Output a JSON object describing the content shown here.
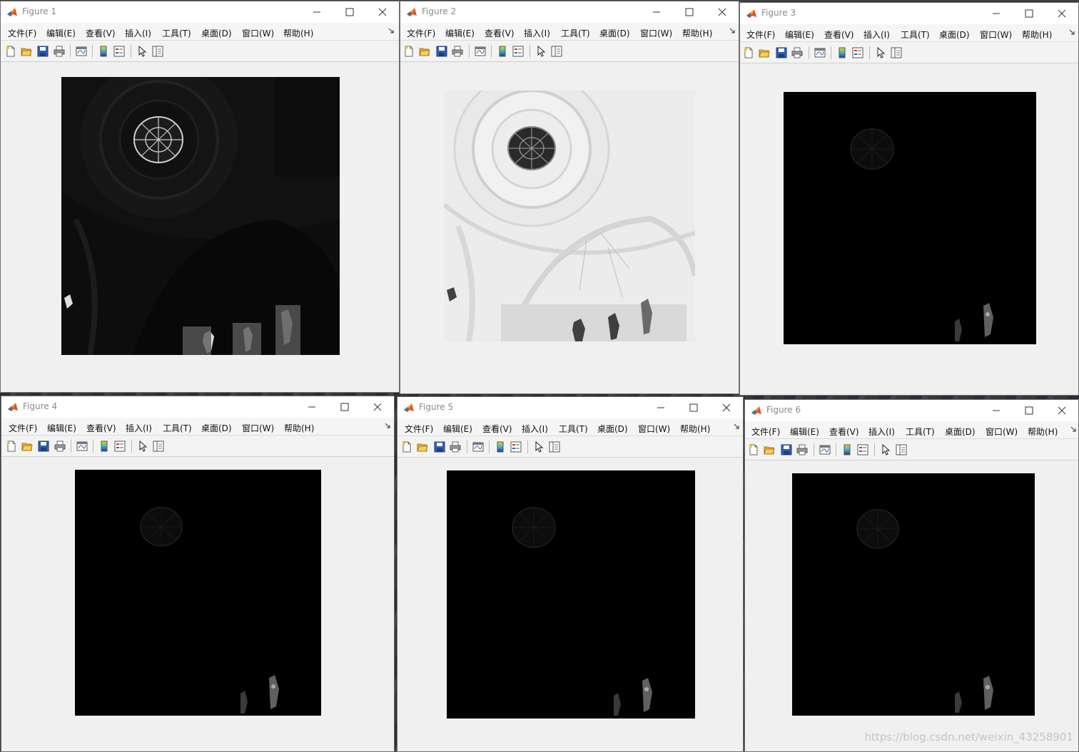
{
  "menu": [
    "文件(F)",
    "编辑(E)",
    "查看(V)",
    "插入(I)",
    "工具(T)",
    "桌面(D)",
    "窗口(W)",
    "帮助(H)"
  ],
  "toolbar_icons": [
    "new-figure-icon",
    "open-file-icon",
    "save-icon",
    "print-icon",
    "link-plot-icon",
    "colorbar-icon",
    "legend-icon",
    "pointer-icon",
    "property-inspector-icon"
  ],
  "figures": [
    {
      "title": "Figure 1",
      "image": "dark-dome-ceiling-grayscale"
    },
    {
      "title": "Figure 2",
      "image": "inverted-dome-ceiling-negative"
    },
    {
      "title": "Figure 3",
      "image": "thresholded-dark-dome"
    },
    {
      "title": "Figure 4",
      "image": "thresholded-dark-dome"
    },
    {
      "title": "Figure 5",
      "image": "thresholded-dark-dome"
    },
    {
      "title": "Figure 6",
      "image": "thresholded-dark-dome"
    }
  ],
  "watermark": "https://blog.csdn.net/weixin_43258901",
  "colors": {
    "window_bg": "#f0f0f0",
    "titlebar_bg": "#ffffff",
    "plot_dark": "#000000",
    "plot_light": "#ececec"
  }
}
